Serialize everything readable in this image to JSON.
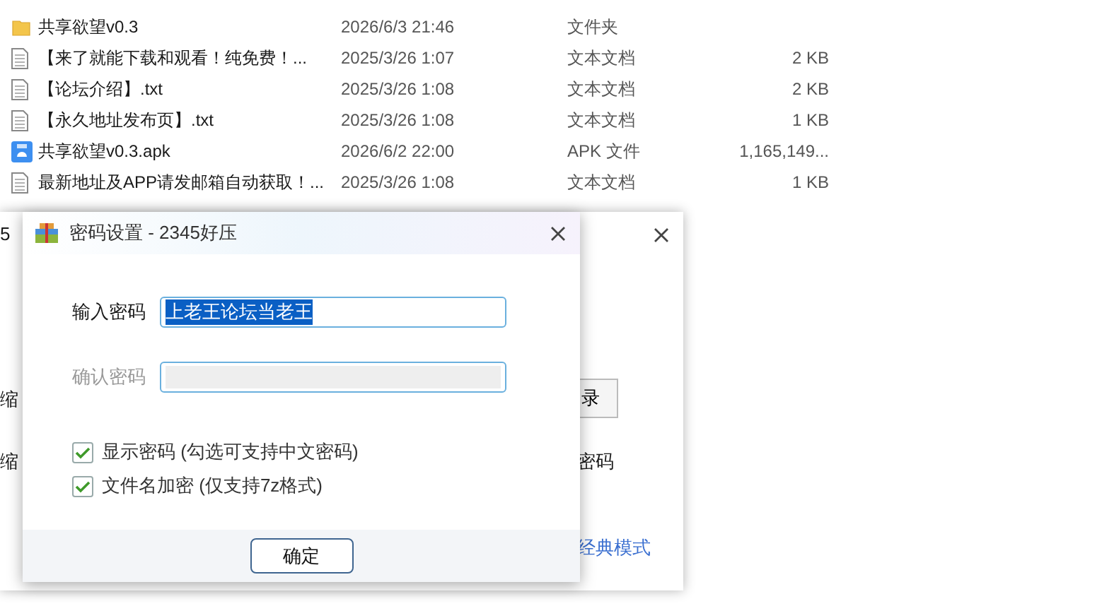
{
  "files": [
    {
      "kind": "folder",
      "name": "共享欲望v0.3",
      "date": "2026/6/3 21:46",
      "type": "文件夹"
    },
    {
      "kind": "text",
      "name": "【来了就能下载和观看！纯免费！...",
      "date": "2025/3/26 1:07",
      "type": "文本文档",
      "size": "2 KB"
    },
    {
      "kind": "text",
      "name": "【论坛介绍】.txt",
      "date": "2025/3/26 1:08",
      "type": "文本文档",
      "size": "2 KB"
    },
    {
      "kind": "text",
      "name": "【永久地址发布页】.txt",
      "date": "2025/3/26 1:08",
      "type": "文本文档",
      "size": "1 KB"
    },
    {
      "kind": "apk",
      "name": "共享欲望v0.3.apk",
      "date": "2026/6/2 22:00",
      "type": "APK 文件",
      "size": "1,165,149..."
    },
    {
      "kind": "text",
      "name": "最新地址及APP请发邮箱自动获取！...",
      "date": "2025/3/26 1:08",
      "type": "文本文档",
      "size": "1 KB"
    }
  ],
  "back_window": {
    "title": "5",
    "row_1_label": "缩",
    "row_1_button": "录",
    "row_2_label": "缩",
    "row_2_text": "密码",
    "link": "经典模式"
  },
  "dialog": {
    "title": "密码设置 - 2345好压",
    "fields": [
      {
        "label": "输入密码",
        "value": "上老王论坛当老王",
        "highlighted": true,
        "disabled": false
      },
      {
        "label": "确认密码",
        "disabled": true
      }
    ],
    "checkboxes": [
      {
        "label": "显示密码 (勾选可支持中文密码)",
        "checked": true
      },
      {
        "label": "文件名加密  (仅支持7z格式)",
        "checked": true
      }
    ],
    "ok_button": "确定"
  }
}
